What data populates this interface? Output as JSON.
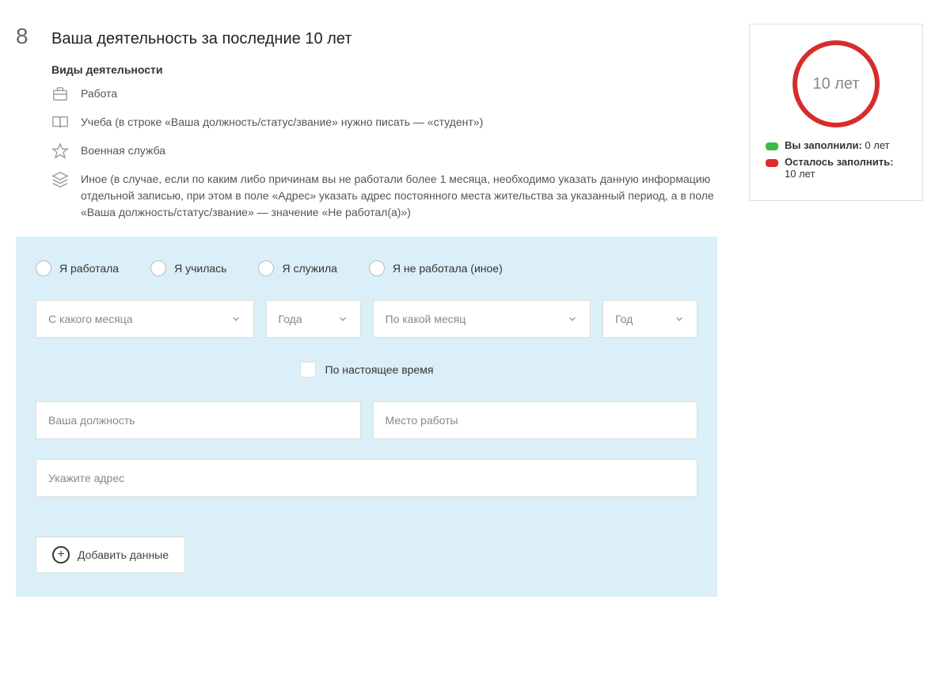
{
  "section": {
    "number": "8",
    "title": "Ваша деятельность за последние 10 лет",
    "subtitle": "Виды деятельности"
  },
  "activities": {
    "work": "Работа",
    "study": "Учеба (в строке «Ваша должность/статус/звание» нужно писать — «студент»)",
    "military": "Военная служба",
    "other": "Иное (в случае, если по каким либо причинам вы не работали более 1 месяца, необходимо указать данную информацию отдельной записью, при этом в поле «Адрес» указать адрес постоянного места жительства за указанный период, а в поле «Ваша должность/статус/звание» — значение «Не работал(а)»)"
  },
  "form": {
    "radios": {
      "worked": "Я работала",
      "studied": "Я училась",
      "served": "Я служила",
      "none": "Я не работала (иное)"
    },
    "fromMonth": "С какого месяца",
    "fromYear": "Года",
    "toMonth": "По какой месяц",
    "toYear": "Год",
    "present": "По настоящее время",
    "position": "Ваша должность",
    "workplace": "Место работы",
    "address": "Укажите адрес",
    "addButton": "Добавить данные"
  },
  "card": {
    "ringLabel": "10 лет",
    "filledLabel": "Вы заполнили:",
    "filledValue": " 0 лет",
    "remainLabel": "Осталось заполнить:",
    "remainValue": " 10 лет"
  }
}
